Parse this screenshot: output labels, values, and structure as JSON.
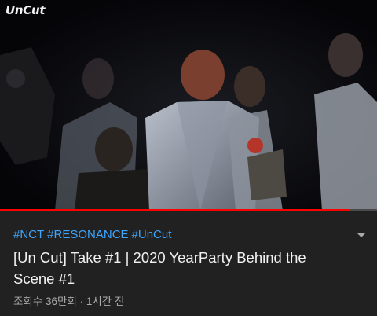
{
  "video": {
    "watermark": "UnCut",
    "progress": 0.93
  },
  "info": {
    "hashtags": [
      "#NCT",
      "#RESONANCE",
      "#UnCut"
    ],
    "title": "[Un Cut] Take #1 | 2020 YearParty Behind the Scene #1",
    "stats": "조회수 36만회 · 1시간 전"
  },
  "colors": {
    "background": "#212121",
    "hashtag": "#3ea6ff",
    "progress": "#ff0000"
  },
  "icons": {
    "expand": "chevron-down-icon"
  }
}
